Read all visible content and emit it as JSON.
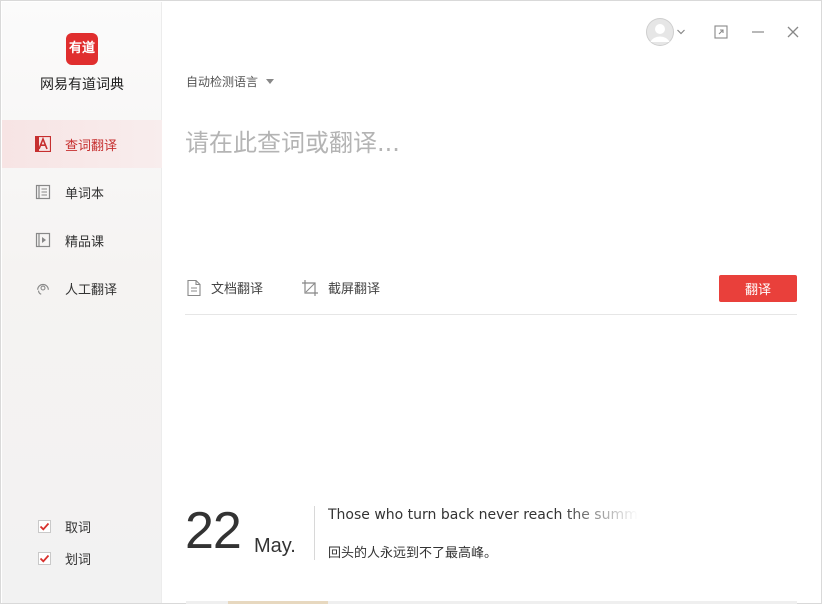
{
  "app": {
    "logo_text": "有道",
    "name": "网易有道词典"
  },
  "sidebar": {
    "items": [
      {
        "label": "查词翻译",
        "icon": "translate-a-icon",
        "active": true
      },
      {
        "label": "单词本",
        "icon": "notebook-icon",
        "active": false
      },
      {
        "label": "精品课",
        "icon": "play-course-icon",
        "active": false
      },
      {
        "label": "人工翻译",
        "icon": "headset-icon",
        "active": false
      }
    ],
    "options": [
      {
        "label": "取词",
        "checked": true
      },
      {
        "label": "划词",
        "checked": true
      }
    ]
  },
  "titlebar": {
    "icons": [
      "avatar-icon",
      "chevron-down-icon",
      "maximize-icon",
      "minimize-icon",
      "close-icon"
    ]
  },
  "main": {
    "language_select": "自动检测语言",
    "query_placeholder": "请在此查词或翻译...",
    "query_value": "",
    "doc_translate": "文档翻译",
    "screenshot_translate": "截屏翻译",
    "translate_button": "翻译"
  },
  "daily": {
    "day": "22",
    "month": "May.",
    "quote_en": "Those who turn back never reach the summit",
    "quote_cn": "回头的人永远到不了最高峰。"
  },
  "colors": {
    "accent": "#e9403b",
    "active_text": "#c62f2f",
    "logo": "#e02e2e"
  }
}
